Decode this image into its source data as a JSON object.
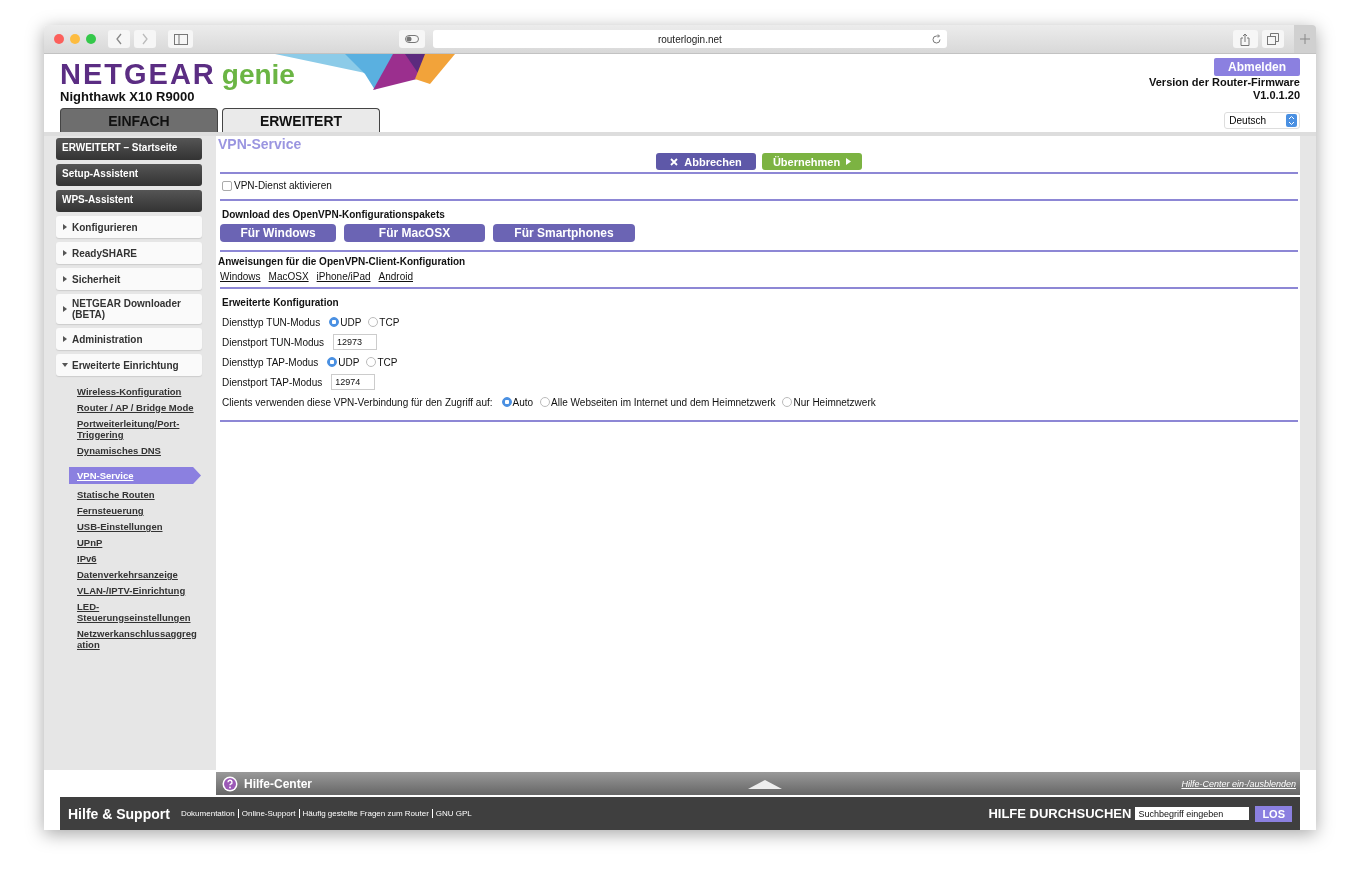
{
  "browser": {
    "url": "routerlogin.net"
  },
  "header": {
    "brand": "NETGEAR",
    "product": "genie",
    "model": "Nighthawk X10 R9000",
    "logout": "Abmelden",
    "firmware_label": "Version der Router-Firmware",
    "firmware_version": "V1.0.1.20",
    "language": "Deutsch"
  },
  "tabs": [
    {
      "label": "EINFACH",
      "selected": false
    },
    {
      "label": "ERWEITERT",
      "selected": true
    }
  ],
  "sidebar": {
    "items": [
      {
        "kind": "main",
        "label": "ERWEITERT – Startseite"
      },
      {
        "kind": "main",
        "label": "Setup-Assistent"
      },
      {
        "kind": "main",
        "label": "WPS-Assistent"
      },
      {
        "kind": "section",
        "label": "Konfigurieren",
        "expanded": false
      },
      {
        "kind": "section",
        "label": "ReadySHARE",
        "expanded": false
      },
      {
        "kind": "section",
        "label": "Sicherheit",
        "expanded": false
      },
      {
        "kind": "section",
        "label": "NETGEAR Downloader (BETA)",
        "expanded": false
      },
      {
        "kind": "section",
        "label": "Administration",
        "expanded": false
      },
      {
        "kind": "section",
        "label": "Erweiterte Einrichtung",
        "expanded": true,
        "children": [
          {
            "label": "Wireless-Konfiguration",
            "selected": false
          },
          {
            "label": "Router / AP / Bridge Mode",
            "selected": false
          },
          {
            "label": "Portweiterleitung/Port-Triggering",
            "selected": false
          },
          {
            "label": "Dynamisches DNS",
            "selected": false
          },
          {
            "label": "VPN-Service",
            "selected": true
          },
          {
            "label": "Statische Routen",
            "selected": false
          },
          {
            "label": "Fernsteuerung",
            "selected": false
          },
          {
            "label": "USB-Einstellungen",
            "selected": false
          },
          {
            "label": "UPnP",
            "selected": false
          },
          {
            "label": "IPv6",
            "selected": false
          },
          {
            "label": "Datenverkehrsanzeige",
            "selected": false
          },
          {
            "label": "VLAN-/IPTV-Einrichtung",
            "selected": false
          },
          {
            "label": "LED-Steuerungseinstellungen",
            "selected": false
          },
          {
            "label": "Netzwerkanschlussaggregation",
            "selected": false
          }
        ]
      }
    ]
  },
  "content": {
    "title": "VPN-Service",
    "cancel": "Abbrechen",
    "apply": "Übernehmen",
    "enable": {
      "label": "VPN-Dienst aktivieren",
      "checked": false
    },
    "download": {
      "heading": "Download des OpenVPN-Konfigurationspakets",
      "buttons": [
        "Für Windows",
        "Für MacOSX",
        "Für Smartphones"
      ]
    },
    "instructions": {
      "heading": "Anweisungen für die OpenVPN-Client-Konfiguration",
      "links": [
        "Windows",
        "MacOSX",
        "iPhone/iPad",
        "Android"
      ]
    },
    "advanced": {
      "heading": "Erweiterte Konfiguration",
      "rows": [
        {
          "kind": "radio",
          "label": "Diensttyp TUN-Modus",
          "options": [
            {
              "label": "UDP",
              "selected": true
            },
            {
              "label": "TCP",
              "selected": false
            }
          ]
        },
        {
          "kind": "input",
          "label": "Dienstport TUN-Modus",
          "value": "12973"
        },
        {
          "kind": "radio",
          "label": "Diensttyp TAP-Modus",
          "options": [
            {
              "label": "UDP",
              "selected": true
            },
            {
              "label": "TCP",
              "selected": false
            }
          ]
        },
        {
          "kind": "input",
          "label": "Dienstport TAP-Modus",
          "value": "12974"
        },
        {
          "kind": "radio",
          "label": "Clients verwenden diese VPN-Verbindung für den Zugriff auf:",
          "options": [
            {
              "label": "Auto",
              "selected": true
            },
            {
              "label": "Alle Webseiten im Internet und dem Heimnetzwerk",
              "selected": false
            },
            {
              "label": "Nur Heimnetzwerk",
              "selected": false
            }
          ]
        }
      ]
    }
  },
  "help_bar": {
    "title": "Hilfe-Center",
    "toggle": "Hilfe-Center ein-/ausblenden"
  },
  "footer": {
    "title": "Hilfe & Support",
    "links": [
      "Dokumentation",
      "Online-Support",
      "Häufig gestellte Fragen zum Router",
      "GNU GPL"
    ],
    "search_label": "HILFE DURCHSUCHEN",
    "search_placeholder": "Suchbegriff eingeben",
    "search_button": "LOS"
  }
}
